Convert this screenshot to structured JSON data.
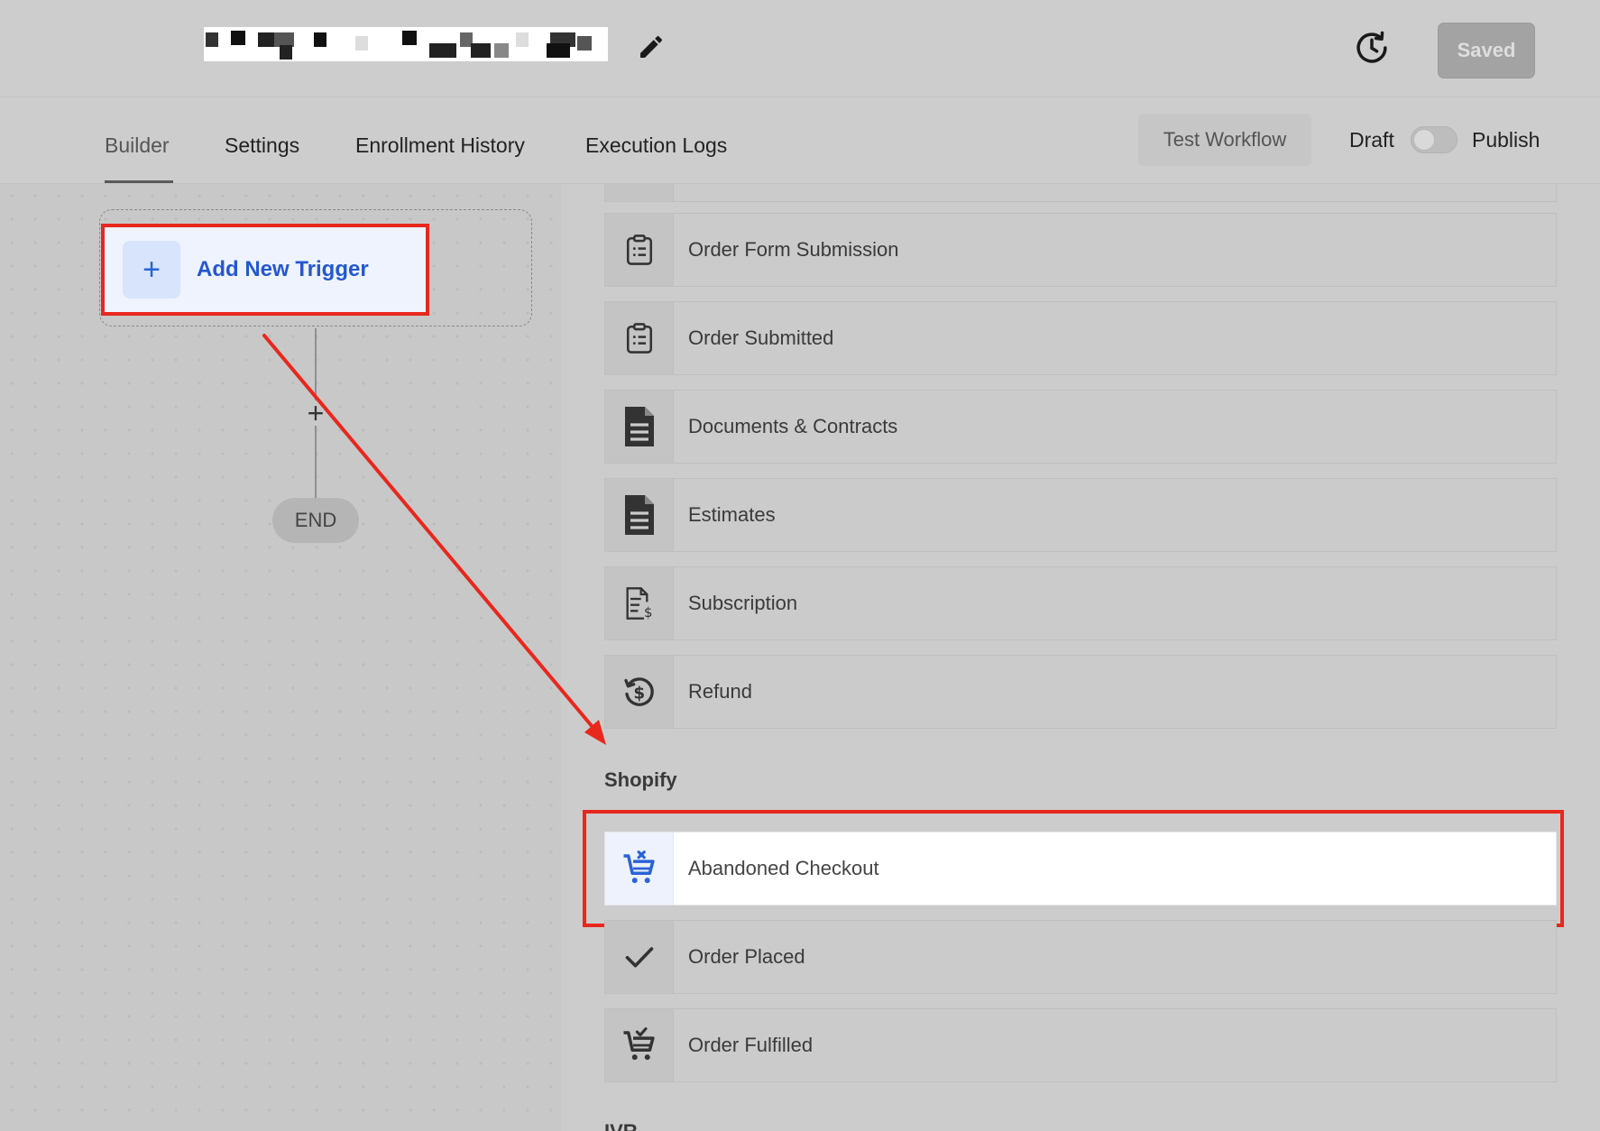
{
  "header": {
    "saved_label": "Saved",
    "edit_icon": "pencil-icon",
    "history_icon": "history-icon"
  },
  "tabs": {
    "builder": "Builder",
    "settings": "Settings",
    "enrollment_history": "Enrollment History",
    "execution_logs": "Execution Logs",
    "test_workflow": "Test Workflow",
    "draft": "Draft",
    "publish": "Publish",
    "publish_toggle_on": false
  },
  "canvas": {
    "add_trigger_label": "Add New Trigger",
    "add_trigger_icon": "+",
    "plus_node": "+",
    "end_label": "END"
  },
  "triggers": {
    "items": [
      {
        "label": "Order Form Submission",
        "icon": "clipboard-list-icon"
      },
      {
        "label": "Order Submitted",
        "icon": "clipboard-list-icon"
      },
      {
        "label": "Documents & Contracts",
        "icon": "document-icon"
      },
      {
        "label": "Estimates",
        "icon": "document-icon"
      },
      {
        "label": "Subscription",
        "icon": "invoice-dollar-icon"
      },
      {
        "label": "Refund",
        "icon": "refund-icon"
      }
    ],
    "shopify_title": "Shopify",
    "shopify_items": [
      {
        "label": "Abandoned Checkout",
        "icon": "cart-x-icon",
        "highlighted": true
      },
      {
        "label": "Order Placed",
        "icon": "check-icon"
      },
      {
        "label": "Order Fulfilled",
        "icon": "cart-check-icon"
      }
    ],
    "next_section_title": "IVR"
  },
  "colors": {
    "annotation_red": "#e8271d",
    "link_blue": "#2458cf",
    "accent_blue_bg": "#d7e4fb"
  }
}
